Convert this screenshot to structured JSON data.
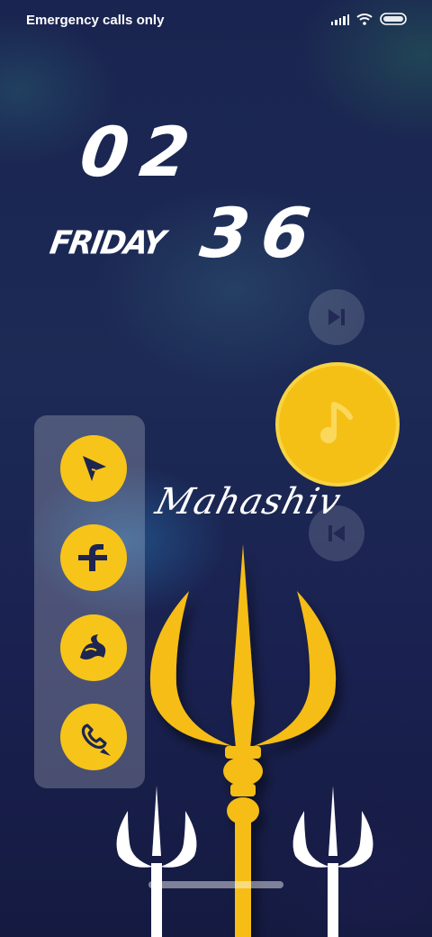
{
  "status_bar": {
    "carrier_text": "Emergency calls only",
    "icons": [
      "signal-icon",
      "wifi-icon",
      "battery-icon"
    ]
  },
  "clock": {
    "hours": "02",
    "minutes": "36",
    "day": "FRIDAY"
  },
  "media": {
    "next_icon": "skip-next-icon",
    "music_icon": "music-note-icon",
    "prev_icon": "skip-previous-icon"
  },
  "dock": {
    "apps": [
      "cursor-icon",
      "facebook-icon",
      "firefox-icon",
      "whatsapp-icon"
    ]
  },
  "signature": "Mahashiv",
  "colors": {
    "accent": "#f7c41a",
    "background": "#1b2552",
    "text": "#ffffff"
  }
}
